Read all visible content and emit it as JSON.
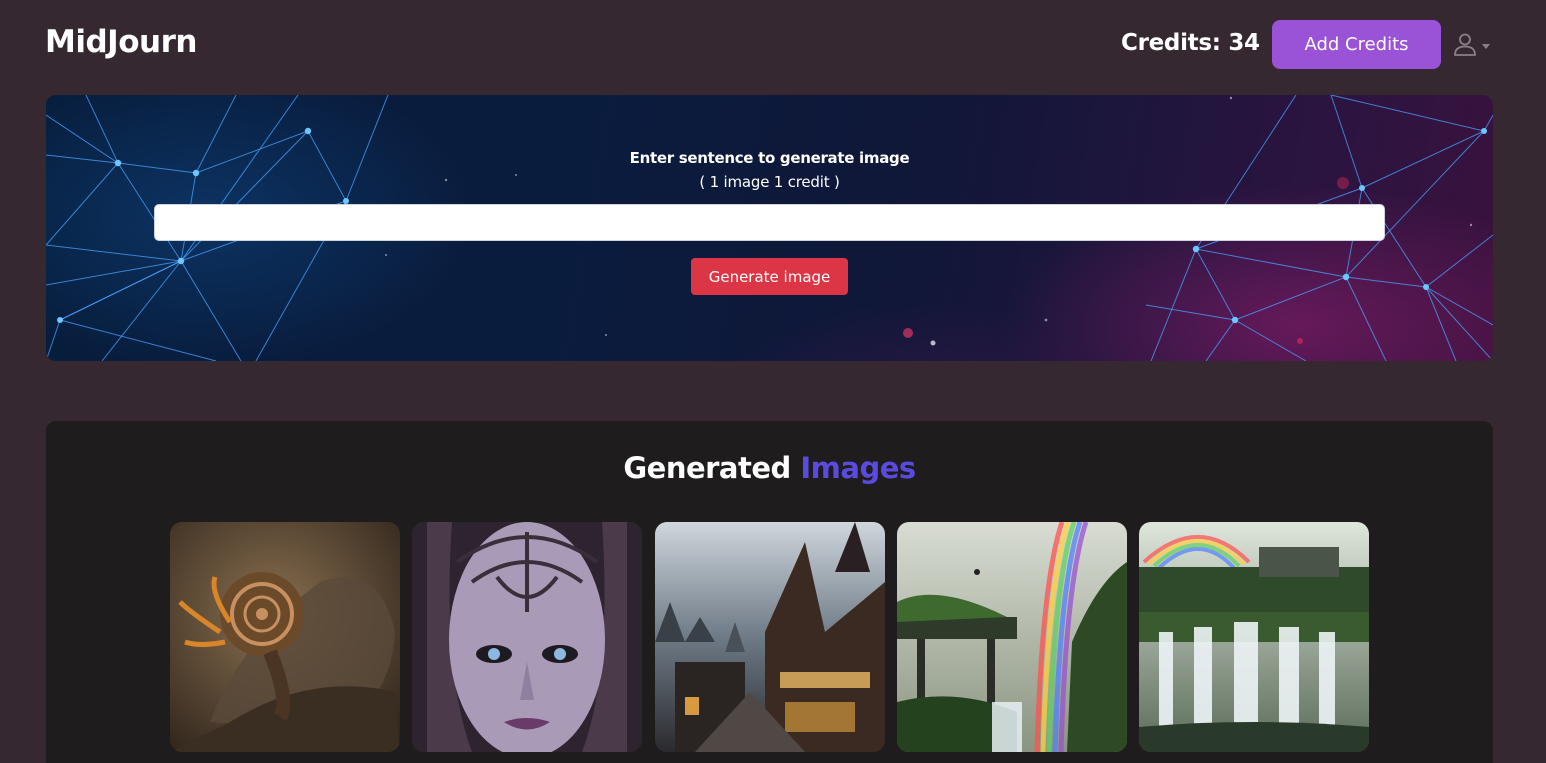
{
  "header": {
    "brand": "MidJourn",
    "credits_label": "Credits: 34",
    "add_credits_label": "Add Credits"
  },
  "hero": {
    "title": "Enter sentence to generate image",
    "subtitle": "( 1 image 1 credit )",
    "prompt_value": "",
    "prompt_placeholder": "",
    "generate_label": "Generate image"
  },
  "gallery": {
    "title_plain": "Generated ",
    "title_accent": "Images",
    "images": [
      {
        "subject": "snail-creature"
      },
      {
        "subject": "elf-face"
      },
      {
        "subject": "gothic-town"
      },
      {
        "subject": "rainbow-ruins"
      },
      {
        "subject": "waterfall-ruins"
      }
    ]
  },
  "colors": {
    "page_bg": "#362830",
    "accent_purple": "#9a52d6",
    "generate_red": "#dc3545",
    "title_accent": "#5a4be0",
    "gallery_bg": "#1f1c1e"
  },
  "icons": [
    "user-icon",
    "caret-down-icon"
  ]
}
